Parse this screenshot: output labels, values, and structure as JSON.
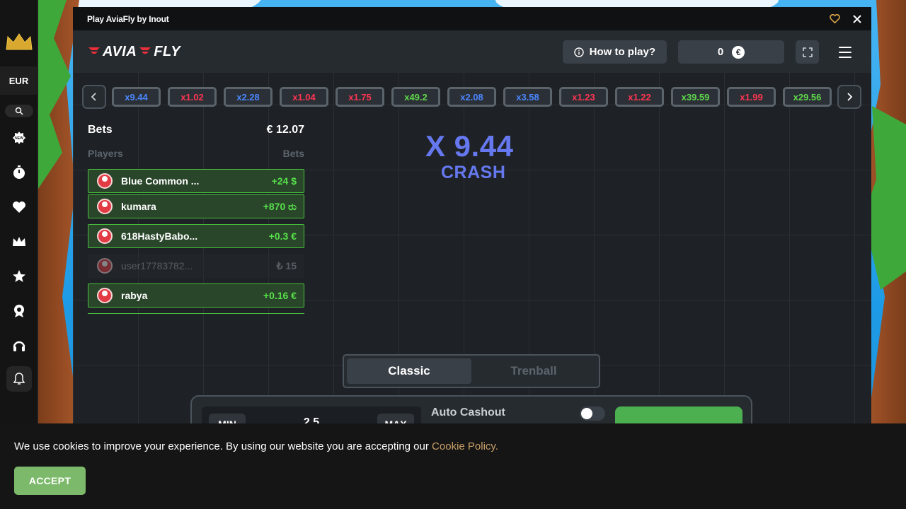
{
  "window": {
    "title": "Play AviaFly by Inout"
  },
  "site_sidebar": {
    "currency": "EUR",
    "icons": [
      "crown-icon",
      "search-icon",
      "new-badge-icon",
      "stopwatch-icon",
      "heart-icon",
      "crown-small-icon",
      "star-icon",
      "medal-icon",
      "headset-icon",
      "bell-icon"
    ]
  },
  "game_header": {
    "logo_left": "AVIA",
    "logo_right": "FLY",
    "how_to_play": "How to play?",
    "balance": "0",
    "currency_symbol": "€"
  },
  "history": [
    {
      "label": "x9.44",
      "color": "blue"
    },
    {
      "label": "x1.02",
      "color": "red"
    },
    {
      "label": "x2.28",
      "color": "blue"
    },
    {
      "label": "x1.04",
      "color": "red"
    },
    {
      "label": "x1.75",
      "color": "red"
    },
    {
      "label": "x49.2",
      "color": "green"
    },
    {
      "label": "x2.08",
      "color": "blue"
    },
    {
      "label": "x3.58",
      "color": "blue"
    },
    {
      "label": "x1.23",
      "color": "red"
    },
    {
      "label": "x1.22",
      "color": "red"
    },
    {
      "label": "x39.59",
      "color": "green"
    },
    {
      "label": "x1.99",
      "color": "red"
    },
    {
      "label": "x29.56",
      "color": "green"
    }
  ],
  "bets": {
    "title": "Bets",
    "total": "€ 12.07",
    "col_players": "Players",
    "col_bets": "Bets",
    "rows": [
      {
        "name": "Blue Common ...",
        "amount": "+24 $",
        "active": true
      },
      {
        "name": "kumara",
        "amount": "+870 ರು",
        "active": true
      },
      {
        "name": "618HastyBabo...",
        "amount": "+0.3 €",
        "active": true
      },
      {
        "name": "user17783782...",
        "amount": "₺ 15",
        "active": false
      },
      {
        "name": "rabya",
        "amount": "+0.16 €",
        "active": true
      }
    ]
  },
  "crash": {
    "multiplier": "X 9.44",
    "label": "CRASH"
  },
  "modes": {
    "classic": "Classic",
    "trenball": "Trenball"
  },
  "bet_controls": {
    "min": "MIN",
    "max": "MAX",
    "amount": "2.5",
    "auto_cashout": "Auto Cashout"
  },
  "cookie": {
    "text": "We use cookies to improve your experience. By using our website you are accepting our ",
    "link": "Cookie Policy.",
    "accept": "ACCEPT"
  },
  "colors": {
    "history_blue": "#4a86ff",
    "history_red": "#ff3451",
    "history_green": "#5fd84b",
    "crash": "#6678f0",
    "win_green": "#57e04a"
  }
}
